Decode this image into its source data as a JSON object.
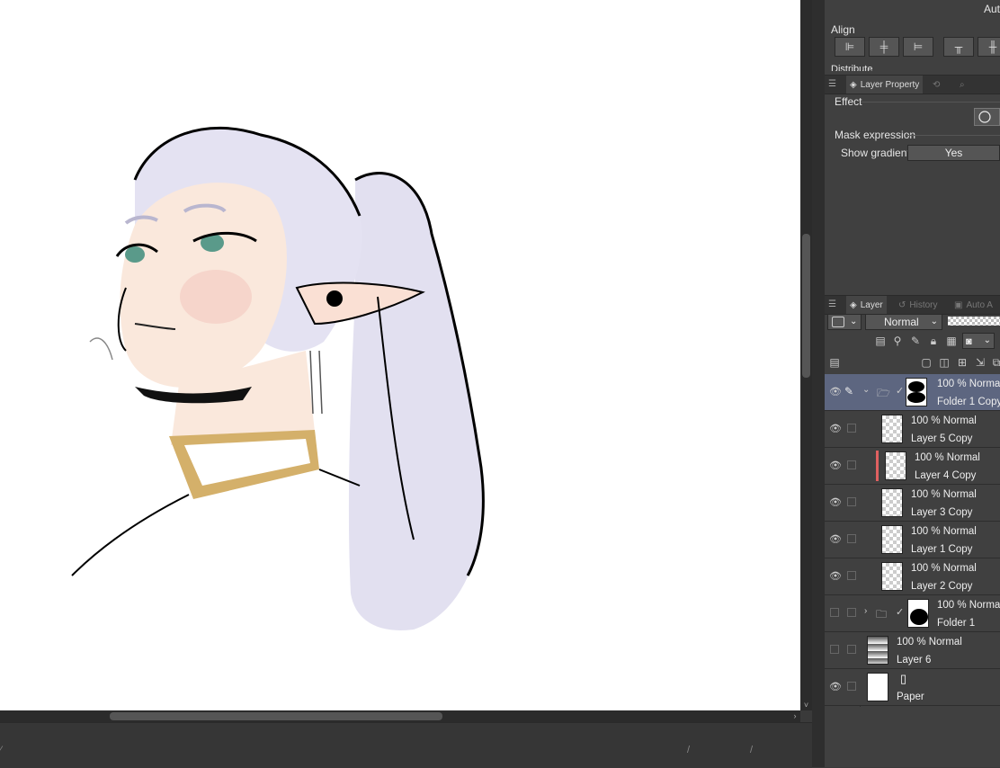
{
  "panel": {
    "auto_label": "Auto",
    "align_label": "Align",
    "distribute_label": "Distribute",
    "property_tab": "Layer Property",
    "effect_label": "Effect",
    "mask_label": "Mask expression",
    "show_gradients_label": "Show gradients",
    "show_gradients_value": "Yes"
  },
  "layer_panel": {
    "tabs": [
      "Layer",
      "History",
      "Auto A"
    ],
    "blend_mode": "Normal",
    "layers": [
      {
        "mode": "100 % Normal",
        "name": "Folder 1 Copy",
        "type": "folder",
        "selected": true,
        "visible": true
      },
      {
        "mode": "100 % Normal",
        "name": "Layer 5 Copy",
        "type": "layer",
        "visible": true
      },
      {
        "mode": "100 % Normal",
        "name": "Layer 4 Copy",
        "type": "layer",
        "visible": true
      },
      {
        "mode": "100 % Normal",
        "name": "Layer 3 Copy",
        "type": "layer",
        "visible": true
      },
      {
        "mode": "100 % Normal",
        "name": "Layer 1 Copy",
        "type": "layer",
        "visible": true
      },
      {
        "mode": "100 % Normal",
        "name": "Layer 2 Copy",
        "type": "layer",
        "visible": true
      },
      {
        "mode": "100 % Normal",
        "name": "Folder 1",
        "type": "folder",
        "visible": false
      },
      {
        "mode": "100 % Normal",
        "name": "Layer 6",
        "type": "layer",
        "visible": false
      },
      {
        "mode": "",
        "name": "Paper",
        "type": "paper",
        "visible": true
      }
    ]
  }
}
